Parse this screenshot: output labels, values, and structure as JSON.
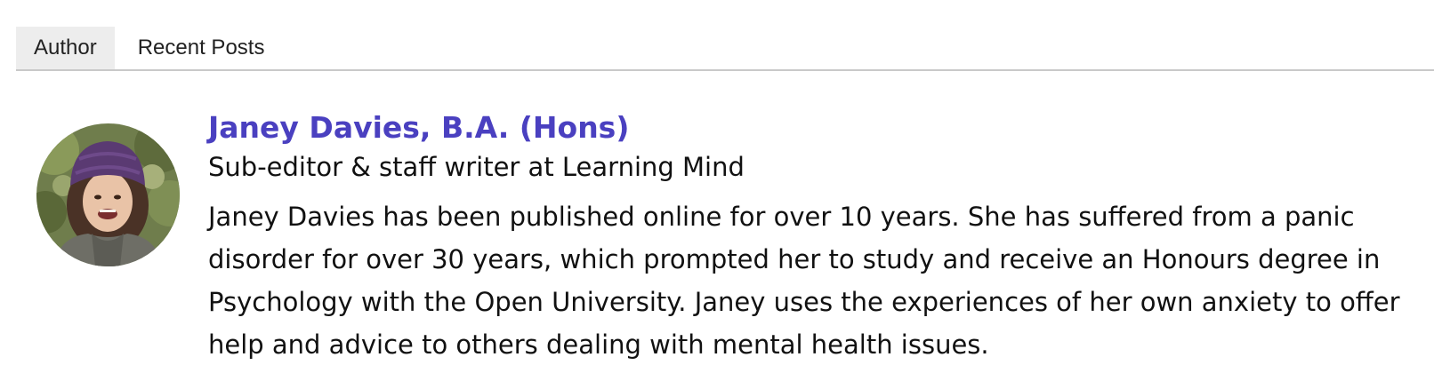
{
  "tabs": [
    {
      "label": "Author",
      "active": true
    },
    {
      "label": "Recent Posts",
      "active": false
    }
  ],
  "author": {
    "name": "Janey Davies, B.A. (Hons)",
    "role": "Sub-editor & staff writer at Learning Mind",
    "bio": "Janey Davies has been published online for over 10 years. She has suffered from a panic disorder for over 30 years, which prompted her to study and receive an Honours degree in Psychology with the Open University. Janey uses the experiences of her own anxiety to offer help and advice to others dealing with mental health issues."
  },
  "colors": {
    "name_link": "#4a40c0",
    "active_tab_bg": "#ededed",
    "tab_border": "#c9c9c9"
  }
}
